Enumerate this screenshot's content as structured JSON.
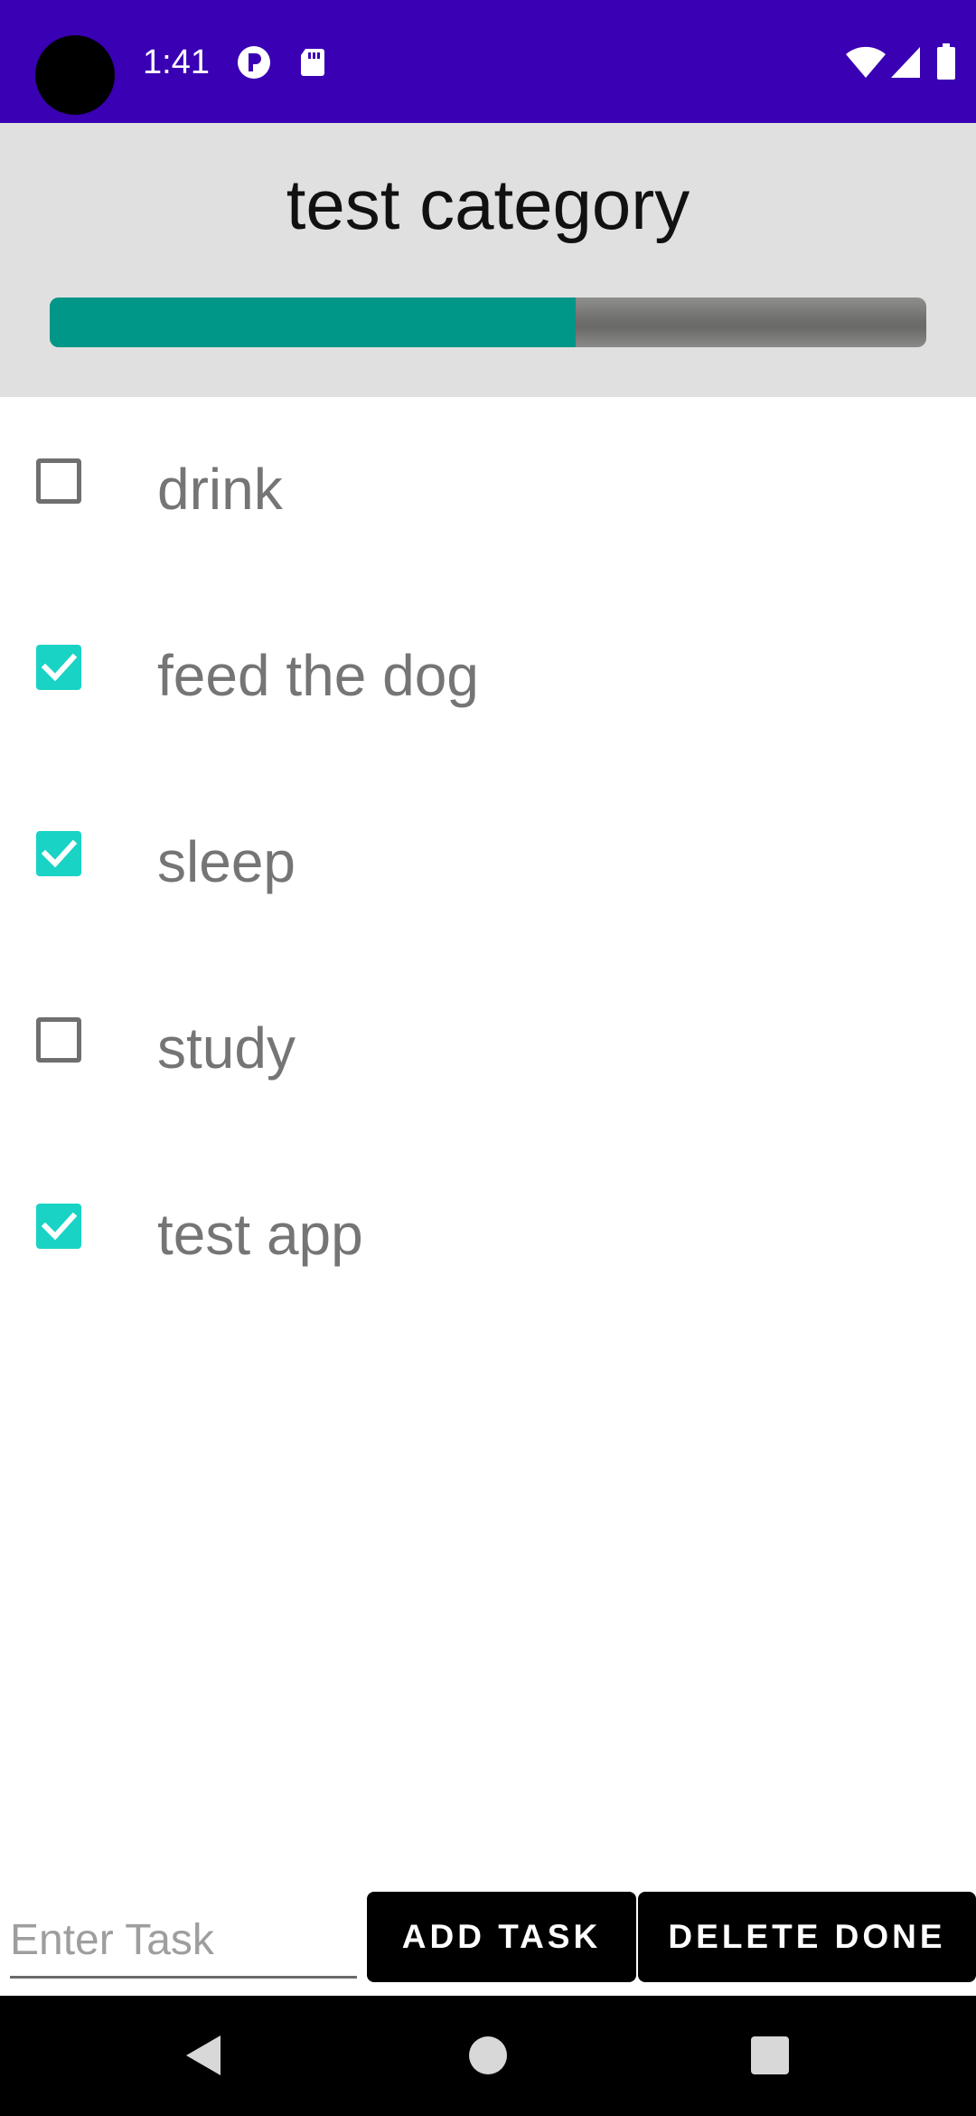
{
  "status_bar": {
    "time": "1:41",
    "background": "#3a00b3",
    "left_icons": [
      "notification-p-icon",
      "sd-card-icon"
    ],
    "right_icons": [
      "wifi-icon",
      "cell-signal-icon",
      "battery-icon"
    ]
  },
  "header": {
    "title": "test category",
    "progress": 0.6,
    "progress_color": "#009688"
  },
  "tasks": [
    {
      "label": "drink",
      "checked": false
    },
    {
      "label": "feed the dog",
      "checked": true
    },
    {
      "label": "sleep",
      "checked": true
    },
    {
      "label": "study",
      "checked": false
    },
    {
      "label": "test app",
      "checked": true
    }
  ],
  "input": {
    "value": "",
    "placeholder": "Enter Task"
  },
  "buttons": {
    "add_label": "ADD TASK",
    "delete_label": "DELETE DONE"
  },
  "nav_bar": {
    "items": [
      "back-icon",
      "home-icon",
      "recents-icon"
    ]
  },
  "colors": {
    "checkbox_checked": "#19d3c5",
    "checkbox_unchecked": "#6f6f6f",
    "task_text": "#757575"
  }
}
